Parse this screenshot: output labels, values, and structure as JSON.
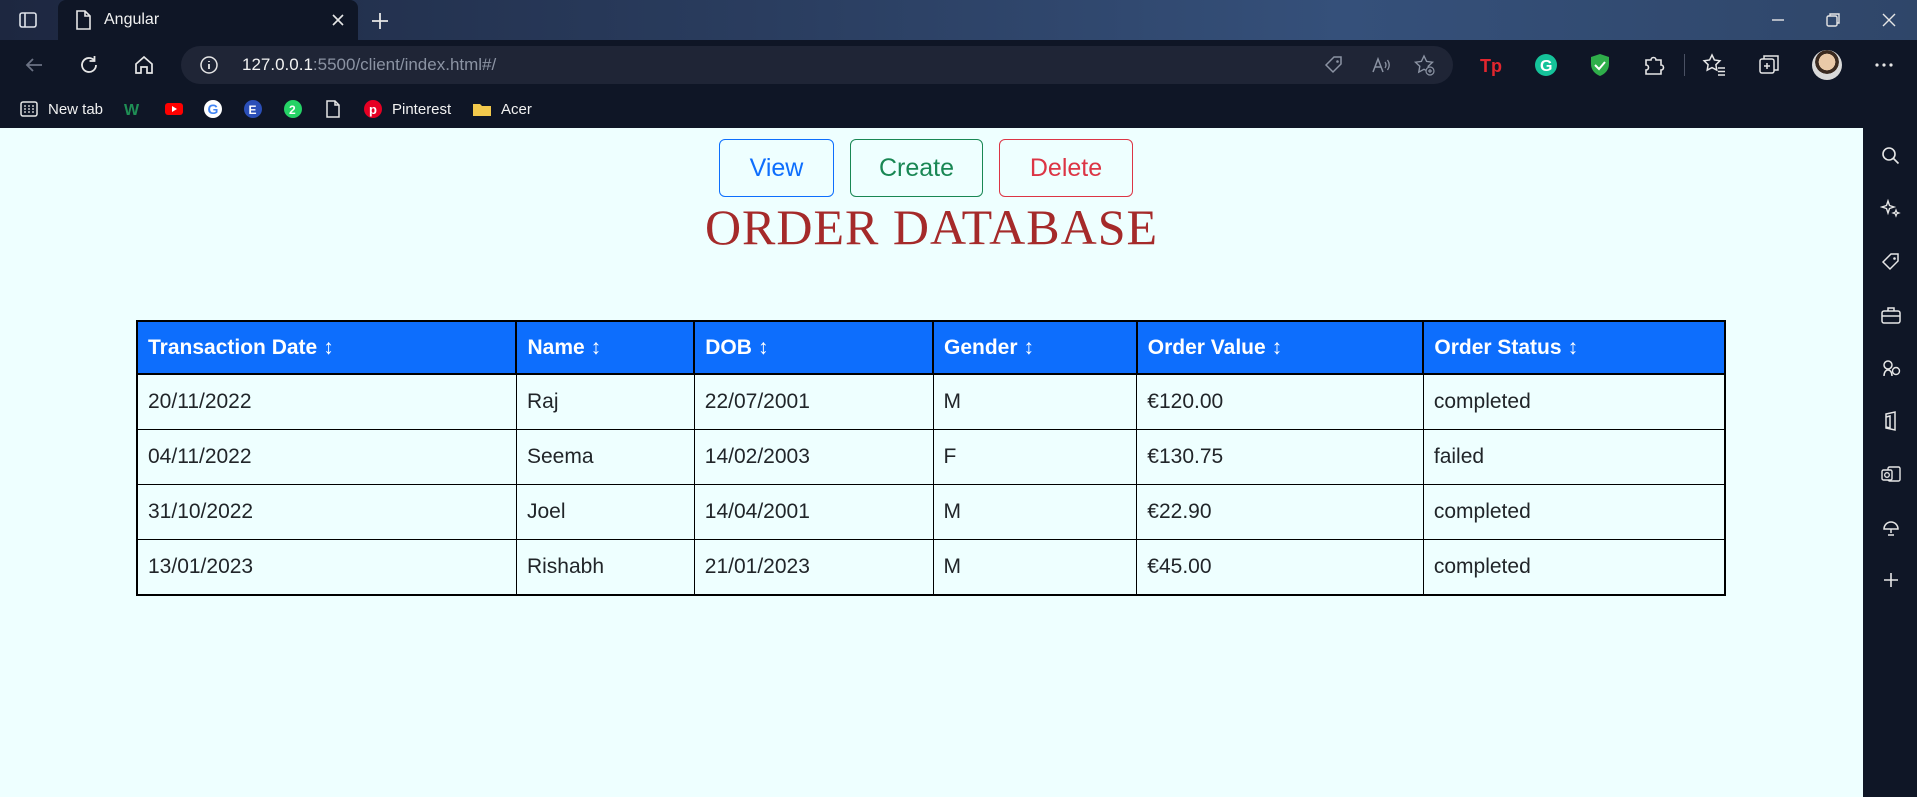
{
  "browser": {
    "tab_title": "Angular",
    "url_host": "127.0.0.1",
    "url_rest": ":5500/client/index.html#/",
    "bookmarks": [
      {
        "label": "New tab",
        "icon": "grid-icon"
      },
      {
        "label": "",
        "icon": "w-icon"
      },
      {
        "label": "",
        "icon": "youtube-icon"
      },
      {
        "label": "",
        "icon": "google-icon"
      },
      {
        "label": "",
        "icon": "e-icon"
      },
      {
        "label": "",
        "icon": "whatsapp-icon"
      },
      {
        "label": "",
        "icon": "file-icon"
      },
      {
        "label": "Pinterest",
        "icon": "pinterest-icon"
      },
      {
        "label": "Acer",
        "icon": "folder-icon"
      }
    ],
    "extensions": [
      "tp-icon",
      "grammarly-icon",
      "shield-icon",
      "puzzle-icon",
      "favorites-icon",
      "collections-icon"
    ]
  },
  "actions": {
    "view_label": "View",
    "create_label": "Create",
    "delete_label": "Delete"
  },
  "page_title": "ORDER DATABASE",
  "table": {
    "sort_glyph": "↕",
    "headers": [
      "Transaction Date",
      "Name",
      "DOB",
      "Gender",
      "Order Value",
      "Order Status"
    ],
    "rows": [
      [
        "20/11/2022",
        "Raj",
        "22/07/2001",
        "M",
        "€120.00",
        "completed"
      ],
      [
        "04/11/2022",
        "Seema",
        "14/02/2003",
        "F",
        "€130.75",
        "failed"
      ],
      [
        "31/10/2022",
        "Joel",
        "14/04/2001",
        "M",
        "€22.90",
        "completed"
      ],
      [
        "13/01/2023",
        "Rishabh",
        "21/01/2023",
        "M",
        "€45.00",
        "completed"
      ]
    ]
  },
  "colors": {
    "accent_blue": "#0d6efd",
    "success_green": "#198754",
    "danger_red": "#dc3545",
    "title_brown": "#a52a2a",
    "page_bg": "#eeffff"
  }
}
